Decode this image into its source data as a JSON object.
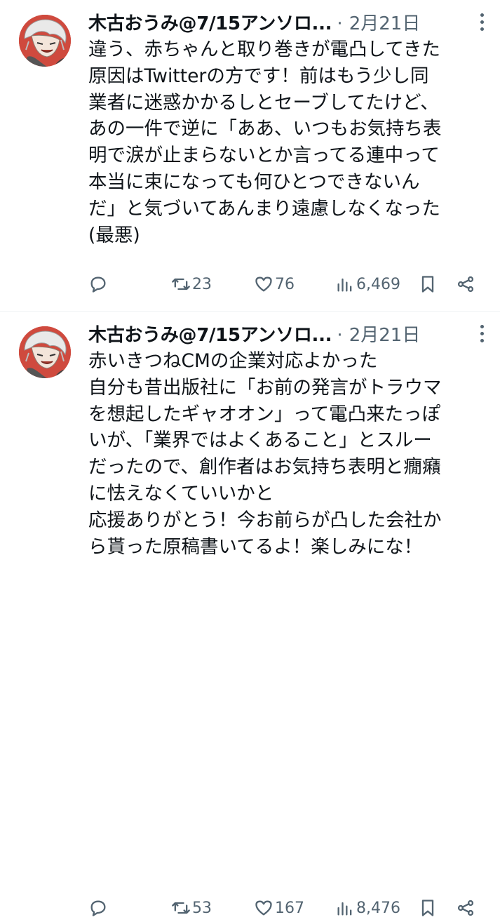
{
  "tweets": [
    {
      "author": "木古おうみ@7/15アンソロ...",
      "separator": "·",
      "date": "2月21日",
      "lines": [
        "違う、赤ちゃんと取り巻きが電凸してきた",
        "原因はTwitterの方です！前はもう少し同",
        "業者に迷惑かかるしとセーブしてたけど、",
        "あの一件で逆に「ああ、いつもお気持ち表",
        "明で涙が止まらないとか言ってる連中って",
        "本当に束になっても何ひとつできないん",
        "だ」と気づいてあんまり遠慮しなくなった",
        "(最悪)"
      ],
      "stats": {
        "retweets": "23",
        "likes": "76",
        "views": "6,469"
      }
    },
    {
      "author": "木古おうみ@7/15アンソロ...",
      "separator": "·",
      "date": "2月21日",
      "lines": [
        "赤いきつねCMの企業対応よかった",
        "自分も昔出版社に「お前の発言がトラウマ",
        "を想起したギャオオン」って電凸来たっぽ",
        "いが、「業界ではよくあること」とスルー",
        "だったので、創作者はお気持ち表明と癇癪",
        "に怯えなくていいかと",
        "応援ありがとう！今お前らが凸した会社か",
        "ら貰った原稿書いてるよ！楽しみにな！"
      ],
      "stats": {
        "retweets": "53",
        "likes": "167",
        "views": "8,476"
      }
    }
  ],
  "icons": {
    "reply": "reply-icon",
    "retweet": "retweet-icon",
    "like": "heart-icon",
    "views": "views-icon",
    "bookmark": "bookmark-icon",
    "share": "share-icon",
    "more": "more-icon"
  },
  "colors": {
    "text": "#0f1419",
    "secondary": "#536471",
    "avatar_bg": "#cf4a3e",
    "divider": "#eff3f4"
  }
}
